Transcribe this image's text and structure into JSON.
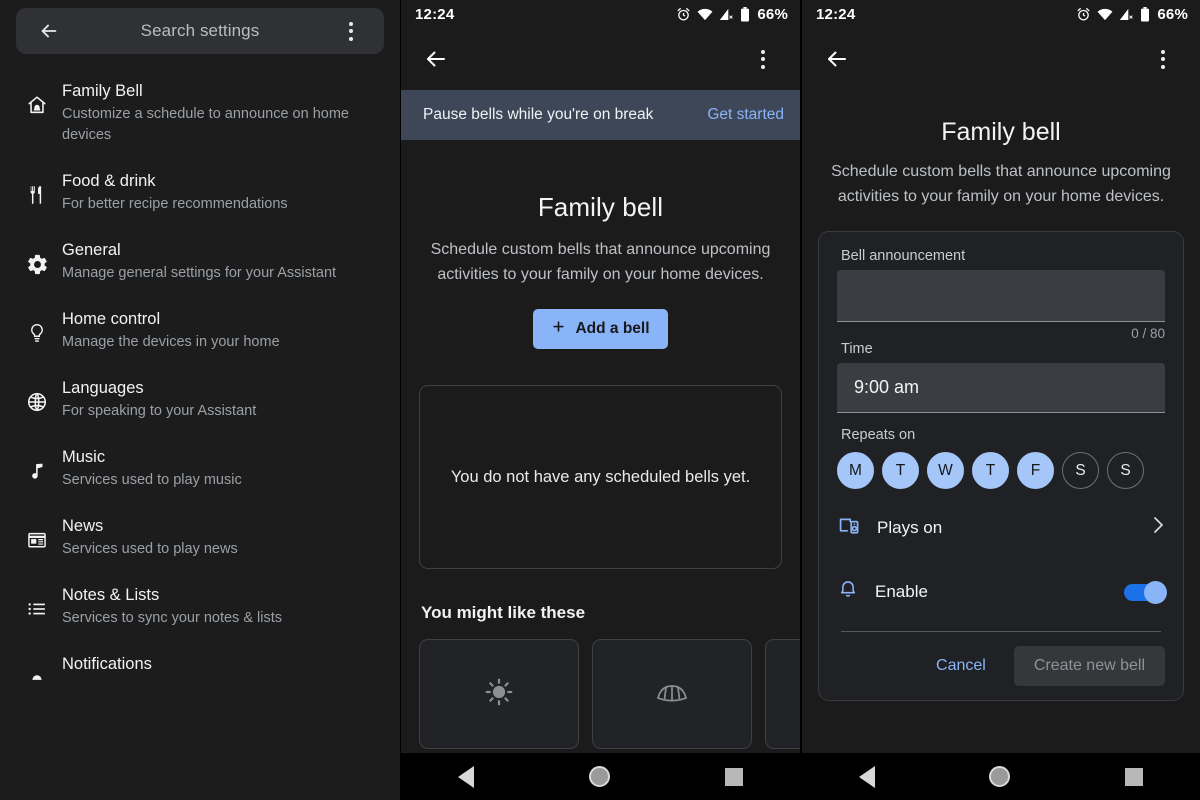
{
  "statusbar": {
    "time": "12:24",
    "battery_percent": "66%",
    "icons": [
      "alarm-icon",
      "wifi-icon",
      "cellular-off-icon",
      "battery-icon"
    ]
  },
  "colors": {
    "accent_blue": "#8ab4f8",
    "day_selected": "#a4c6f8",
    "banner_bg": "#3d4757",
    "toggle_on": "#1b72e8",
    "screen_bg": "#1b1b1b"
  },
  "settings_panel": {
    "search": {
      "placeholder": "Search settings",
      "back_icon": "back-arrow-icon",
      "overflow_icon": "more-vertical-icon"
    },
    "items": [
      {
        "icon": "home-bell-icon",
        "title": "Family Bell",
        "subtitle": "Customize a schedule to announce on home devices"
      },
      {
        "icon": "restaurant-icon",
        "title": "Food & drink",
        "subtitle": "For better recipe recommendations"
      },
      {
        "icon": "gear-icon",
        "title": "General",
        "subtitle": "Manage general settings for your Assistant"
      },
      {
        "icon": "lightbulb-icon",
        "title": "Home control",
        "subtitle": "Manage the devices in your home"
      },
      {
        "icon": "globe-icon",
        "title": "Languages",
        "subtitle": "For speaking to your Assistant"
      },
      {
        "icon": "music-note-icon",
        "title": "Music",
        "subtitle": "Services used to play music"
      },
      {
        "icon": "news-icon",
        "title": "News",
        "subtitle": "Services used to play news"
      },
      {
        "icon": "list-icon",
        "title": "Notes & Lists",
        "subtitle": "Services to sync your notes & lists"
      },
      {
        "icon": "notification-bell-icon",
        "title": "Notifications",
        "subtitle": ""
      }
    ]
  },
  "list_panel": {
    "banner": {
      "text": "Pause bells while you're on break",
      "cta": "Get started"
    },
    "hero": {
      "title": "Family bell",
      "description": "Schedule custom bells that announce upcoming activities to your family on your home devices.",
      "add_button": "Add a bell",
      "add_icon": "plus-icon"
    },
    "empty_state": "You do not have any scheduled bells yet.",
    "suggestions_heading": "You might like these",
    "suggestions": [
      {
        "icon": "sun-icon"
      },
      {
        "icon": "croissant-icon"
      },
      {
        "icon": "partial-card-icon"
      }
    ]
  },
  "create_panel": {
    "hero": {
      "title": "Family bell",
      "description": "Schedule custom bells that announce upcoming activities to your family on your home devices."
    },
    "form": {
      "announcement_label": "Bell announcement",
      "announcement_value": "",
      "announcement_counter": "0 / 80",
      "time_label": "Time",
      "time_value": "9:00 am",
      "repeats_label": "Repeats on",
      "days": [
        {
          "letter": "M",
          "selected": true
        },
        {
          "letter": "T",
          "selected": true
        },
        {
          "letter": "W",
          "selected": true
        },
        {
          "letter": "T",
          "selected": true
        },
        {
          "letter": "F",
          "selected": true
        },
        {
          "letter": "S",
          "selected": false
        },
        {
          "letter": "S",
          "selected": false
        }
      ],
      "plays_on_label": "Plays on",
      "plays_on_icon": "cast-speaker-icon",
      "enable_label": "Enable",
      "enable_icon": "bell-icon",
      "enable_on": true,
      "cancel_label": "Cancel",
      "create_label": "Create new bell"
    }
  },
  "navbar": {
    "back": "nav-back-icon",
    "home": "nav-home-icon",
    "recents": "nav-recents-icon"
  }
}
